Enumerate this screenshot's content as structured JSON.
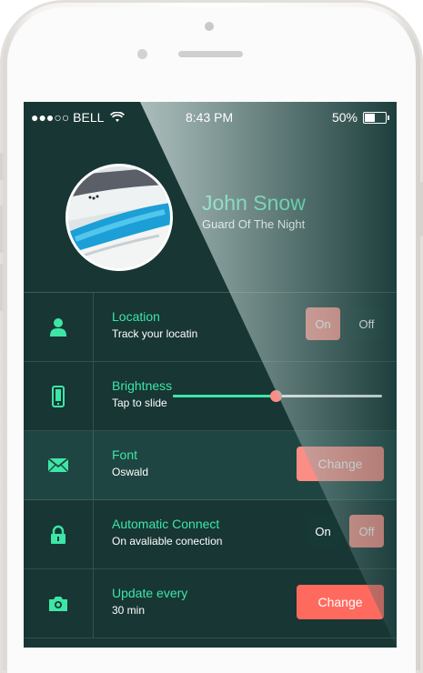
{
  "status_bar": {
    "carrier": "●●●○○ BELL",
    "time": "8:43 PM",
    "battery": "50%",
    "battery_level": 0.5
  },
  "profile": {
    "name": "John Snow",
    "subtitle": "Guard Of The Night"
  },
  "settings": [
    {
      "icon": "person-icon",
      "title": "Location",
      "subtitle": "Track your locatin",
      "control": "toggle",
      "on_label": "On",
      "off_label": "Off",
      "selected": "on"
    },
    {
      "icon": "phone-icon",
      "title": "Brightness",
      "subtitle": "Tap to slide",
      "control": "slider",
      "level": 0.49
    },
    {
      "icon": "mail-icon",
      "title": "Font",
      "subtitle": "Oswald",
      "control": "button",
      "button_label": "Change"
    },
    {
      "icon": "lock-icon",
      "title": "Automatic Connect",
      "subtitle": "On avaliable conection",
      "control": "toggle",
      "on_label": "On",
      "off_label": "Off",
      "selected": "off"
    },
    {
      "icon": "camera-icon",
      "title": "Update every",
      "subtitle": "30 min",
      "control": "button",
      "button_label": "Change"
    }
  ],
  "colors": {
    "accent": "#3ee6a6",
    "button": "#fb8d85",
    "background": "#173634"
  }
}
